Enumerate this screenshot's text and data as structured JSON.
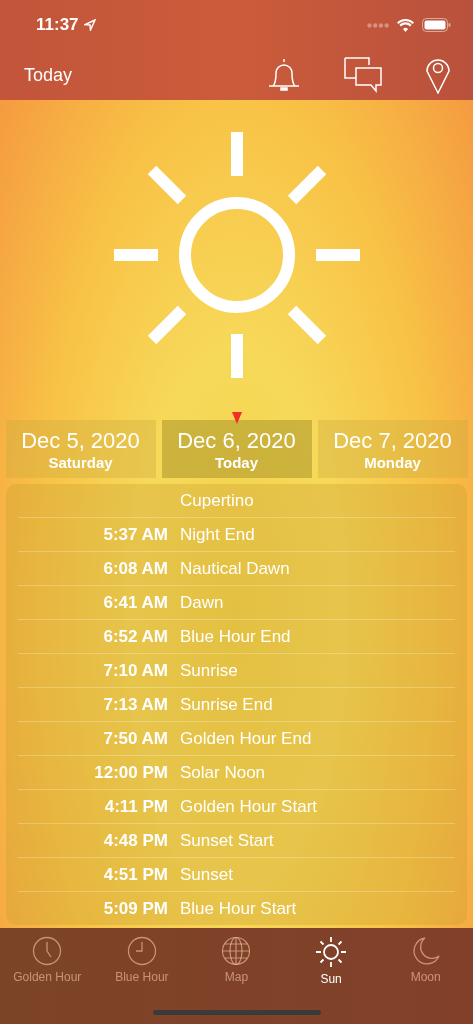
{
  "status_bar": {
    "time": "11:37"
  },
  "nav": {
    "title": "Today"
  },
  "days": [
    {
      "date": "Dec 5, 2020",
      "label": "Saturday",
      "selected": false
    },
    {
      "date": "Dec 6, 2020",
      "label": "Today",
      "selected": true
    },
    {
      "date": "Dec 7, 2020",
      "label": "Monday",
      "selected": false
    }
  ],
  "events": {
    "location": "Cupertino",
    "rows": [
      {
        "time": "5:37 AM",
        "name": "Night End"
      },
      {
        "time": "6:08 AM",
        "name": "Nautical Dawn"
      },
      {
        "time": "6:41 AM",
        "name": "Dawn"
      },
      {
        "time": "6:52 AM",
        "name": "Blue Hour End"
      },
      {
        "time": "7:10 AM",
        "name": "Sunrise"
      },
      {
        "time": "7:13 AM",
        "name": "Sunrise End"
      },
      {
        "time": "7:50 AM",
        "name": "Golden Hour End"
      },
      {
        "time": "12:00 PM",
        "name": "Solar Noon"
      },
      {
        "time": "4:11 PM",
        "name": "Golden Hour Start"
      },
      {
        "time": "4:48 PM",
        "name": "Sunset Start"
      },
      {
        "time": "4:51 PM",
        "name": "Sunset"
      },
      {
        "time": "5:09 PM",
        "name": "Blue Hour Start"
      }
    ]
  },
  "tabs": [
    {
      "label": "Golden Hour",
      "kind": "clock",
      "selected": false
    },
    {
      "label": "Blue Hour",
      "kind": "clock2",
      "selected": false
    },
    {
      "label": "Map",
      "kind": "globe",
      "selected": false
    },
    {
      "label": "Sun",
      "kind": "sun",
      "selected": true
    },
    {
      "label": "Moon",
      "kind": "moon",
      "selected": false
    }
  ]
}
